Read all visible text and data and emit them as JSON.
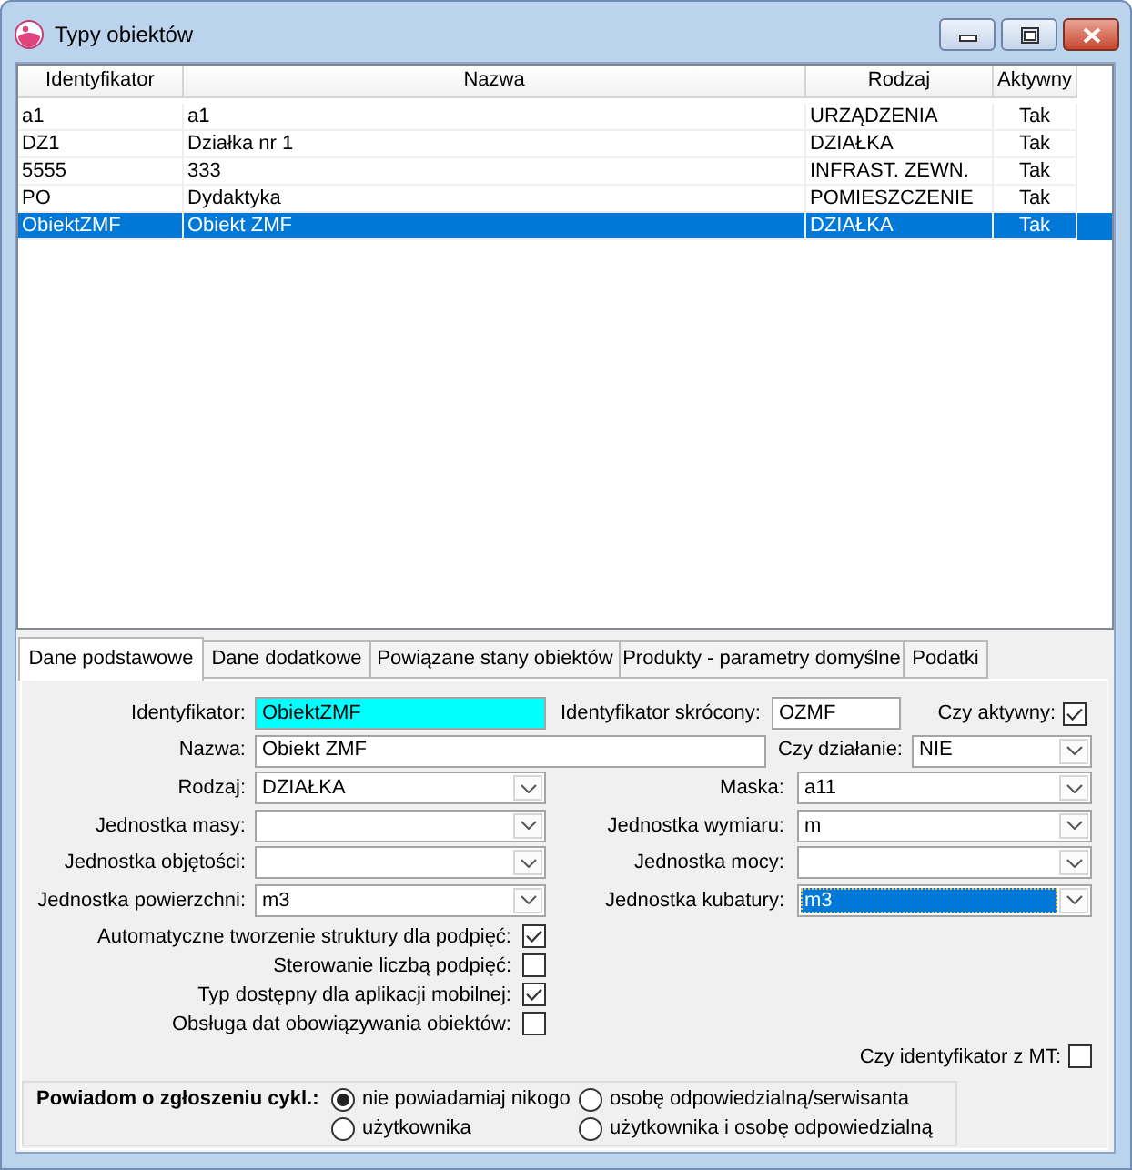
{
  "window": {
    "title": "Typy obiektów"
  },
  "table": {
    "columns": [
      "Identyfikator",
      "Nazwa",
      "Rodzaj",
      "Aktywny"
    ],
    "rows": [
      {
        "cells": [
          "a1",
          "a1",
          "URZĄDZENIA",
          "Tak"
        ],
        "selected": false
      },
      {
        "cells": [
          "DZ1",
          "Działka nr 1",
          "DZIAŁKA",
          "Tak"
        ],
        "selected": false
      },
      {
        "cells": [
          "5555",
          "333",
          "INFRAST. ZEWN.",
          "Tak"
        ],
        "selected": false
      },
      {
        "cells": [
          "PO",
          "Dydaktyka",
          "POMIESZCZENIE",
          "Tak"
        ],
        "selected": false
      },
      {
        "cells": [
          "ObiektZMF",
          "Obiekt ZMF",
          "DZIAŁKA",
          "Tak"
        ],
        "selected": true
      }
    ]
  },
  "tabs": [
    {
      "label": "Dane podstawowe",
      "selected": true
    },
    {
      "label": "Dane dodatkowe",
      "selected": false
    },
    {
      "label": "Powiązane stany obiektów",
      "selected": false
    },
    {
      "label": "Produkty - parametry domyślne",
      "selected": false
    },
    {
      "label": "Podatki",
      "selected": false
    }
  ],
  "form": {
    "rows": [
      [
        {
          "kind": "text",
          "label": "Identyfikator:",
          "value": "ObiektZMF",
          "highlighted": true,
          "focused": false
        },
        {
          "kind": "text",
          "label": "Identyfikator skrócony:",
          "value": "OZMF",
          "highlighted": false,
          "focused": false
        },
        {
          "kind": "checkbox",
          "label": "Czy aktywny:",
          "checked": true
        }
      ],
      [
        {
          "kind": "text",
          "label": "Nazwa:",
          "value": "Obiekt ZMF",
          "highlighted": false,
          "focused": false
        },
        {
          "kind": "select",
          "label": "Czy działanie:",
          "value": "NIE",
          "highlighted": false,
          "focused": false
        }
      ],
      [
        {
          "kind": "select",
          "label": "Rodzaj:",
          "value": "DZIAŁKA",
          "highlighted": false,
          "focused": false
        },
        {
          "kind": "select",
          "label": "Maska:",
          "value": "a11",
          "highlighted": false,
          "focused": false
        }
      ],
      [
        {
          "kind": "select",
          "label": "Jednostka masy:",
          "highlighted": false,
          "focused": false
        },
        {
          "kind": "select",
          "label": "Jednostka wymiaru:",
          "value": "m",
          "highlighted": false,
          "focused": false
        }
      ],
      [
        {
          "kind": "select",
          "label": "Jednostka objętości:",
          "highlighted": false,
          "focused": false
        },
        {
          "kind": "select",
          "label": "Jednostka mocy:",
          "highlighted": false,
          "focused": false
        }
      ],
      [
        {
          "kind": "select",
          "label": "Jednostka powierzchni:",
          "value": "m3",
          "highlighted": false,
          "focused": false
        },
        {
          "kind": "select",
          "label": "Jednostka kubatury:",
          "value": "m3",
          "highlighted": false,
          "focused": true
        }
      ]
    ]
  },
  "flags": [
    {
      "label": "Automatyczne tworzenie struktury dla podpięć:",
      "checked": true
    },
    {
      "label": "Sterowanie liczbą podpięć:",
      "checked": false
    },
    {
      "label": "Typ dostępny dla aplikacji mobilnej:",
      "checked": true
    },
    {
      "label": "Obsługa dat obowiązywania obiektów:",
      "checked": false
    }
  ],
  "mt_flag": {
    "label": "Czy identyfikator z MT:",
    "checked": false
  },
  "notify": {
    "label": "Powiadom o zgłoszeniu cykl.:",
    "options": [
      {
        "label": "nie powiadamiaj nikogo",
        "selected": true
      },
      {
        "label": "osobę odpowiedzialną/serwisanta",
        "selected": false
      },
      {
        "label": "użytkownika",
        "selected": false
      },
      {
        "label": "użytkownika i osobę odpowiedzialną",
        "selected": false
      }
    ]
  }
}
